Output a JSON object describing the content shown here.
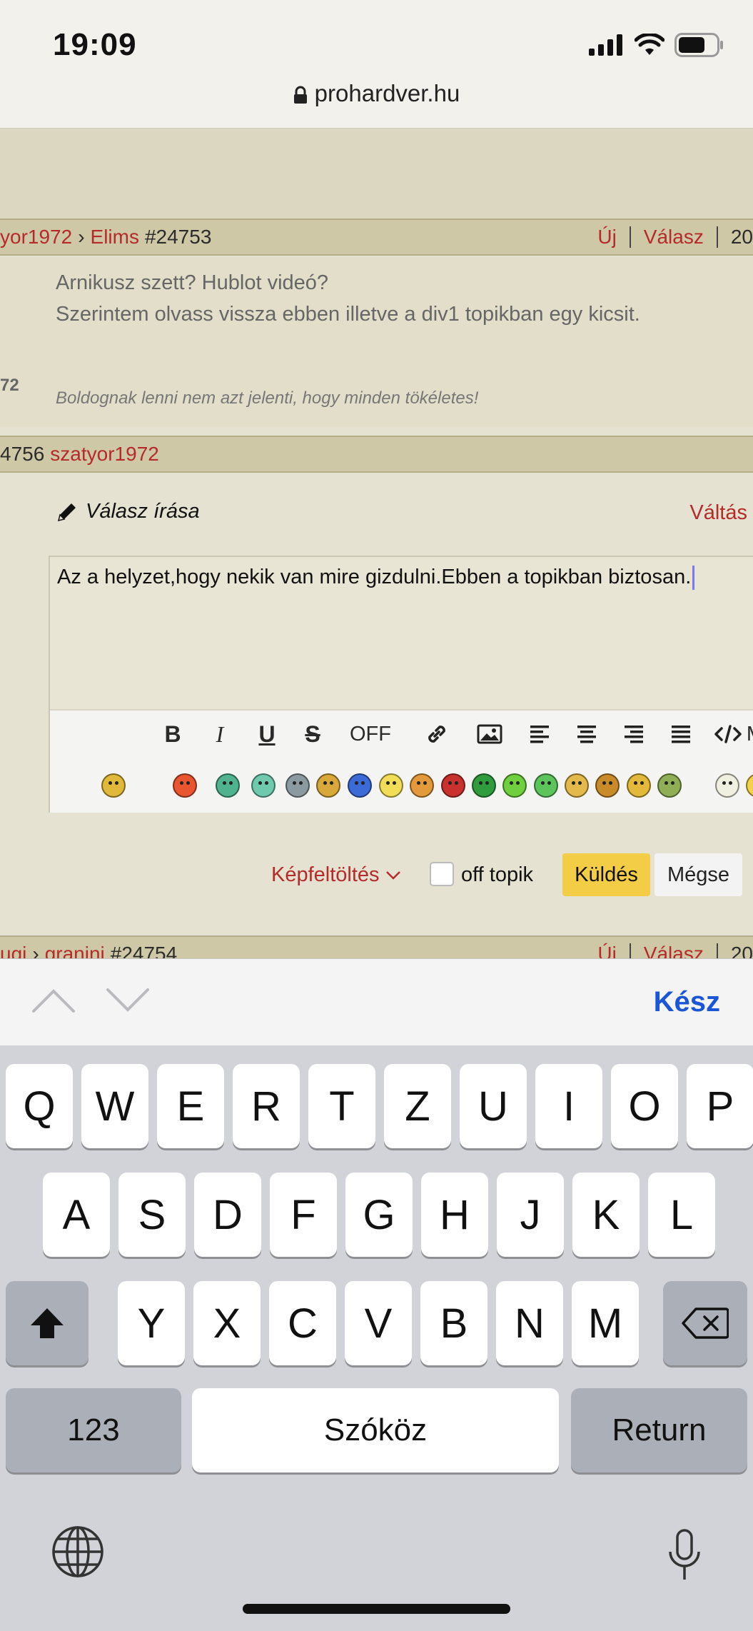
{
  "status": {
    "time": "19:09"
  },
  "browser": {
    "url": "prohardver.hu"
  },
  "posts": {
    "bar1": {
      "author_partial": "yor1972",
      "reply_to": "Elims",
      "number": "#24753",
      "new_label": "Új",
      "reply_label": "Válasz",
      "date_partial": "20"
    },
    "msg1": {
      "line1": "Arnikusz szett? Hublot videó?",
      "line2": "Szerintem olvass vissza ebben illetve a div1 topikban egy kicsit.",
      "side_fragment": "72",
      "signature": "Boldognak lenni nem azt jelenti, hogy minden tökéletes!"
    },
    "bar2": {
      "number_partial": "4756",
      "author": "szatyor1972"
    },
    "bar3": {
      "author_partial": "ugi",
      "reply_to": "granini",
      "number": "#24754",
      "new_label": "Új",
      "reply_label": "Válasz",
      "date_partial": "20"
    }
  },
  "reply": {
    "title": "Válasz írása",
    "switch_label": "Váltás",
    "text": "Az a helyzet,hogy nekik van mire gizdulni.Ebben a topikban biztosan.",
    "toolbar": {
      "bold": "B",
      "italic": "I",
      "underline": "U",
      "strike": "S",
      "off": "OFF",
      "more_partial": "M"
    },
    "smiley_colors": [
      "#e0b93a",
      "#e8552e",
      "#4fb38e",
      "#6fc9ad",
      "#8a9aa0",
      "#d8a93a",
      "#3c6ad6",
      "#f1dd57",
      "#e39a3a",
      "#c8312d",
      "#2f9d3d",
      "#6fcf3e",
      "#5bc45a",
      "#e2b94a",
      "#c98a2a",
      "#e2b93a",
      "#8fae55",
      "#f0f0e0",
      "#f3d24a"
    ]
  },
  "actions": {
    "upload_label": "Képfeltöltés",
    "offtopic_label": "off topik",
    "send_label": "Küldés",
    "cancel_label": "Mégse"
  },
  "keyboard": {
    "done_label": "Kész",
    "row1": [
      "Q",
      "W",
      "E",
      "R",
      "T",
      "Z",
      "U",
      "I",
      "O",
      "P"
    ],
    "row2": [
      "A",
      "S",
      "D",
      "F",
      "G",
      "H",
      "J",
      "K",
      "L"
    ],
    "row3": [
      "Y",
      "X",
      "C",
      "V",
      "B",
      "N",
      "M"
    ],
    "numbers_label": "123",
    "space_label": "Szóköz",
    "return_label": "Return"
  }
}
